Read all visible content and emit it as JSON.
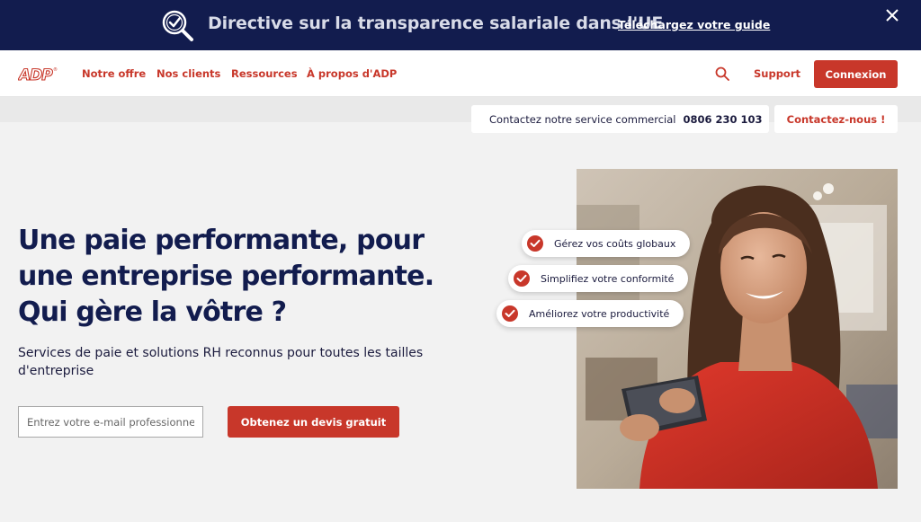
{
  "banner": {
    "text": "Directive sur la transparence salariale dans l'UE",
    "link": "Téléchargez votre guide",
    "icon": "magnifier-check-icon",
    "close_icon": "close-icon"
  },
  "header": {
    "logo_text": "ADP",
    "nav": [
      "Notre offre",
      "Nos clients",
      "Ressources",
      "À propos d'ADP"
    ],
    "support": "Support",
    "login": "Connexion",
    "search_icon": "search-icon"
  },
  "contact": {
    "label": "Contactez notre service commercial",
    "phone": "0806 230 103",
    "contact_us": "Contactez-nous !"
  },
  "hero": {
    "title_lines": [
      "Une paie performante, pour",
      "une entreprise performante.",
      "Qui gère la vôtre ?"
    ],
    "subtitle": "Services de paie et solutions RH reconnus pour toutes les tailles d'entreprise",
    "email_placeholder": "Entrez votre e-mail professionnel",
    "cta": "Obtenez un devis gratuit"
  },
  "features": [
    "Gérez vos coûts globaux",
    "Simplifiez votre conformité",
    "Améliorez votre productivité"
  ],
  "colors": {
    "brand_red": "#c8372a",
    "navy": "#121c4e",
    "background": "#f2f2f2"
  }
}
